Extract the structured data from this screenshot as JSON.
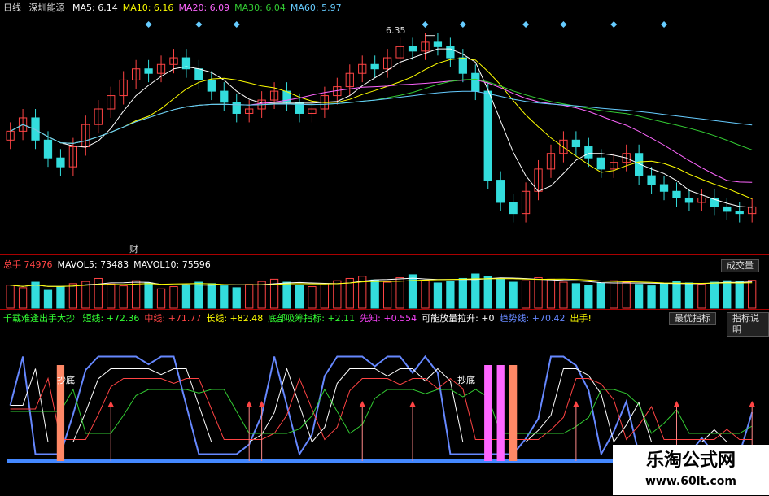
{
  "price_panel": {
    "period": "日线",
    "stock_name": "深圳能源",
    "ma": [
      {
        "label": "MA5:",
        "value": "6.14",
        "color": "#ffffff"
      },
      {
        "label": "MA10:",
        "value": "6.16",
        "color": "#ffff00"
      },
      {
        "label": "MA20:",
        "value": "6.09",
        "color": "#ff66ff"
      },
      {
        "label": "MA30:",
        "value": "6.04",
        "color": "#33cc33"
      },
      {
        "label": "MA60:",
        "value": "5.97",
        "color": "#66ccff"
      }
    ],
    "peak_label": "6.35",
    "marker_label": "财"
  },
  "volume_panel": {
    "items": [
      {
        "label": "总手",
        "value": "74976",
        "color": "#ff4444"
      },
      {
        "label": "MAVOL5:",
        "value": "73483",
        "color": "#ffffff"
      },
      {
        "label": "MAVOL10:",
        "value": "75596",
        "color": "#ffffff"
      }
    ],
    "button": "成交量"
  },
  "indicator_panel": {
    "title": "千载难逢出手大抄",
    "items": [
      {
        "label": "短线:",
        "value": "+72.36",
        "color": "#33ff33"
      },
      {
        "label": "中线:",
        "value": "+71.77",
        "color": "#ff4444"
      },
      {
        "label": "长线:",
        "value": "+82.48",
        "color": "#ffff00"
      },
      {
        "label": "底部吸筹指标:",
        "value": "+2.11",
        "color": "#33ff33"
      },
      {
        "label": "先知:",
        "value": "+0.554",
        "color": "#ff44ff"
      },
      {
        "label": "可能放量拉升:",
        "value": "+0",
        "color": "#ffffff"
      },
      {
        "label": "趋势线:",
        "value": "+70.42",
        "color": "#6688ff"
      },
      {
        "label": "出手!",
        "value": "",
        "color": "#ffff00"
      }
    ],
    "buttons": [
      "最优指标",
      "指标说明"
    ],
    "annotations": [
      "抄底",
      "抄底"
    ]
  },
  "watermark": {
    "title": "乐淘公式网",
    "url": "www.60lt.com"
  },
  "chart_data": {
    "type": "candlestick",
    "title": "",
    "close": [
      5.92,
      5.98,
      5.88,
      5.8,
      5.76,
      5.85,
      5.95,
      6.02,
      6.08,
      6.15,
      6.2,
      6.18,
      6.22,
      6.25,
      6.2,
      6.15,
      6.1,
      6.05,
      6.0,
      6.02,
      6.06,
      6.1,
      6.05,
      6.0,
      6.02,
      6.08,
      6.12,
      6.18,
      6.22,
      6.2,
      6.25,
      6.3,
      6.28,
      6.32,
      6.3,
      6.25,
      6.18,
      6.1,
      5.7,
      5.6,
      5.55,
      5.65,
      5.75,
      5.82,
      5.88,
      5.85,
      5.8,
      5.75,
      5.78,
      5.82,
      5.72,
      5.68,
      5.65,
      5.62,
      5.6,
      5.62,
      5.58,
      5.56,
      5.55,
      5.58
    ],
    "peak_price": 6.35,
    "volume": [
      62,
      55,
      70,
      48,
      58,
      66,
      72,
      80,
      65,
      60,
      74,
      68,
      52,
      58,
      63,
      70,
      66,
      60,
      55,
      64,
      72,
      78,
      70,
      62,
      58,
      66,
      74,
      80,
      86,
      76,
      70,
      82,
      90,
      75,
      68,
      72,
      80,
      92,
      85,
      78,
      70,
      74,
      82,
      78,
      70,
      66,
      62,
      68,
      74,
      70,
      64,
      60,
      66,
      72,
      68,
      64,
      70,
      74,
      72,
      75
    ],
    "indicator": {
      "short_line_last": 72.36,
      "mid_line_last": 71.77,
      "long_line_last": 82.48,
      "trend_line_last": 70.42
    }
  }
}
